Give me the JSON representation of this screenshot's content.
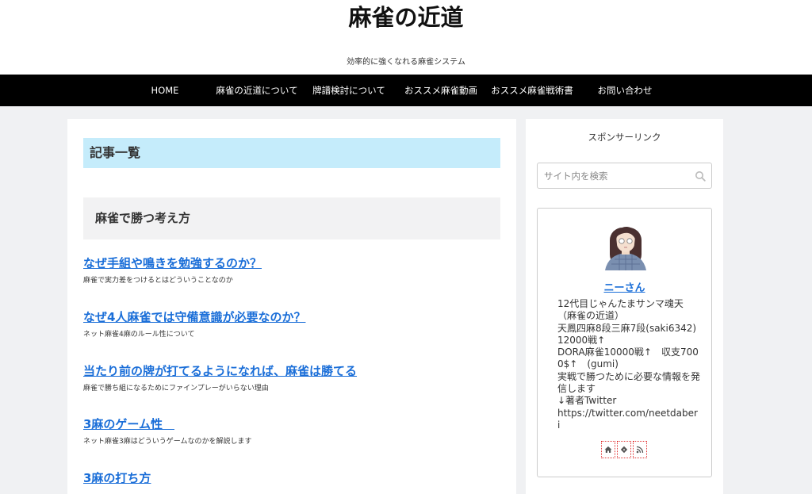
{
  "site": {
    "title": "麻雀の近道",
    "tagline": "効率的に強くなれる麻雀システム"
  },
  "nav": [
    {
      "label": "HOME"
    },
    {
      "label": "麻雀の近道について"
    },
    {
      "label": "牌譜検討について"
    },
    {
      "label": "おススメ麻雀動画"
    },
    {
      "label": "おススメ麻雀戦術書"
    },
    {
      "label": "お問い合わせ"
    }
  ],
  "main": {
    "heading": "記事一覧",
    "category": "麻雀で勝つ考え方",
    "posts": [
      {
        "title": "なぜ手組や鳴きを勉強するのか？",
        "desc": "麻雀で実力差をつけるとはどういうことなのか"
      },
      {
        "title": "なぜ4人麻雀では守備意識が必要なのか？",
        "desc": "ネット麻雀4麻のルール性について"
      },
      {
        "title": "当たり前の牌が打てるようになれば、麻雀は勝てる",
        "desc": "麻雀で勝ち組になるためにファインプレーがいらない理由"
      },
      {
        "title": "3麻のゲーム性　",
        "desc": "ネット麻雀3麻はどういうゲームなのかを解説します"
      },
      {
        "title": "3麻の打ち方",
        "desc": ""
      }
    ]
  },
  "sidebar": {
    "sponsor_label": "スポンサーリンク",
    "search_placeholder": "サイト内を検索",
    "author": {
      "name": "ニーさん",
      "bio": "12代目じゃんたまサンマ魂天（麻雀の近道）\n天鳳四麻8段三麻7段(saki6342)　12000戦↑\nDORA麻雀10000戦↑　収支7000$↑　(gumi)\n実戦で勝つために必要な情報を発信します\n↓著者Twitter\nhttps://twitter.com/neetdaberi"
    },
    "social_icons": [
      "home-icon",
      "feedly-icon",
      "rss-icon"
    ]
  },
  "colors": {
    "accent": "#1a6ed8",
    "heading_bg": "#c5ecfb",
    "nav_bg": "#000000",
    "page_bg": "#f0f1f3"
  }
}
